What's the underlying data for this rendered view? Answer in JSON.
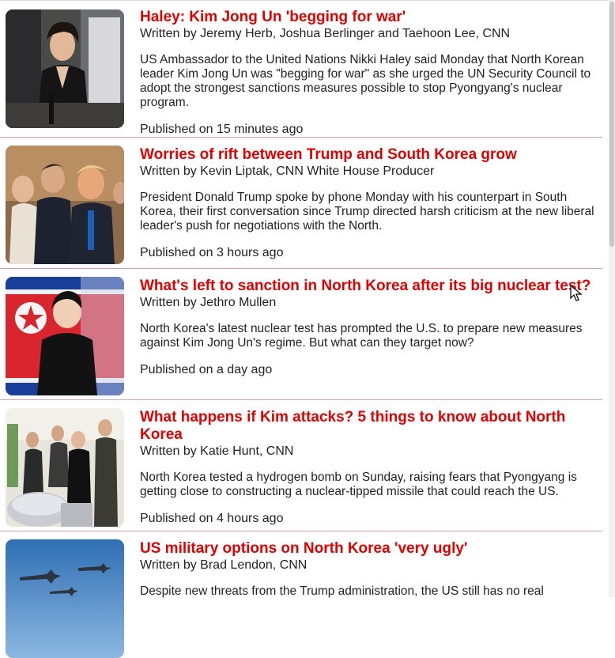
{
  "articles": [
    {
      "title": "Haley: Kim Jong Un 'begging for war'",
      "author": "Written by Jeremy Herb, Joshua Berlinger and Taehoon Lee, CNN",
      "summary": "US Ambassador to the United Nations Nikki Haley said Monday that North Korean leader Kim Jong Un was \"begging for war\" as she urged the UN Security Council to adopt the strongest sanctions measures possible to stop Pyongyang's nuclear program.",
      "published": "Published on 15 minutes ago",
      "image": "photo-speaker-at-un"
    },
    {
      "title": "Worries of rift between Trump and South Korea grow",
      "author": "Written by Kevin Liptak, CNN White House Producer",
      "summary": "President Donald Trump spoke by phone Monday with his counterpart in South Korea, their first conversation since Trump directed harsh criticism at the new liberal leader's push for negotiations with the North.",
      "published": "Published on 3 hours ago",
      "image": "photo-leaders-meeting"
    },
    {
      "title": "What's left to sanction in North Korea after its big nuclear test?",
      "author": "Written by Jethro Mullen",
      "summary": "North Korea's latest nuclear test has prompted the U.S. to prepare new measures against Kim Jong Un's regime. But what can they target now?",
      "published": "Published on a day ago",
      "image": "photo-flag-collage"
    },
    {
      "title": "What happens if Kim attacks? 5 things to know about North Korea",
      "author": "Written by Katie Hunt, CNN",
      "summary": "North Korea tested a hydrogen bomb on Sunday, raising fears that Pyongyang is getting close to constructing a nuclear-tipped missile that could reach the US.",
      "published": "Published on 4 hours ago",
      "image": "photo-inspection"
    },
    {
      "title": "US military options on North Korea 'very ugly'",
      "author": "Written by Brad Lendon, CNN",
      "summary": "Despite new threats from the Trump administration, the US still has no real",
      "published": "",
      "image": "photo-bombers"
    }
  ]
}
